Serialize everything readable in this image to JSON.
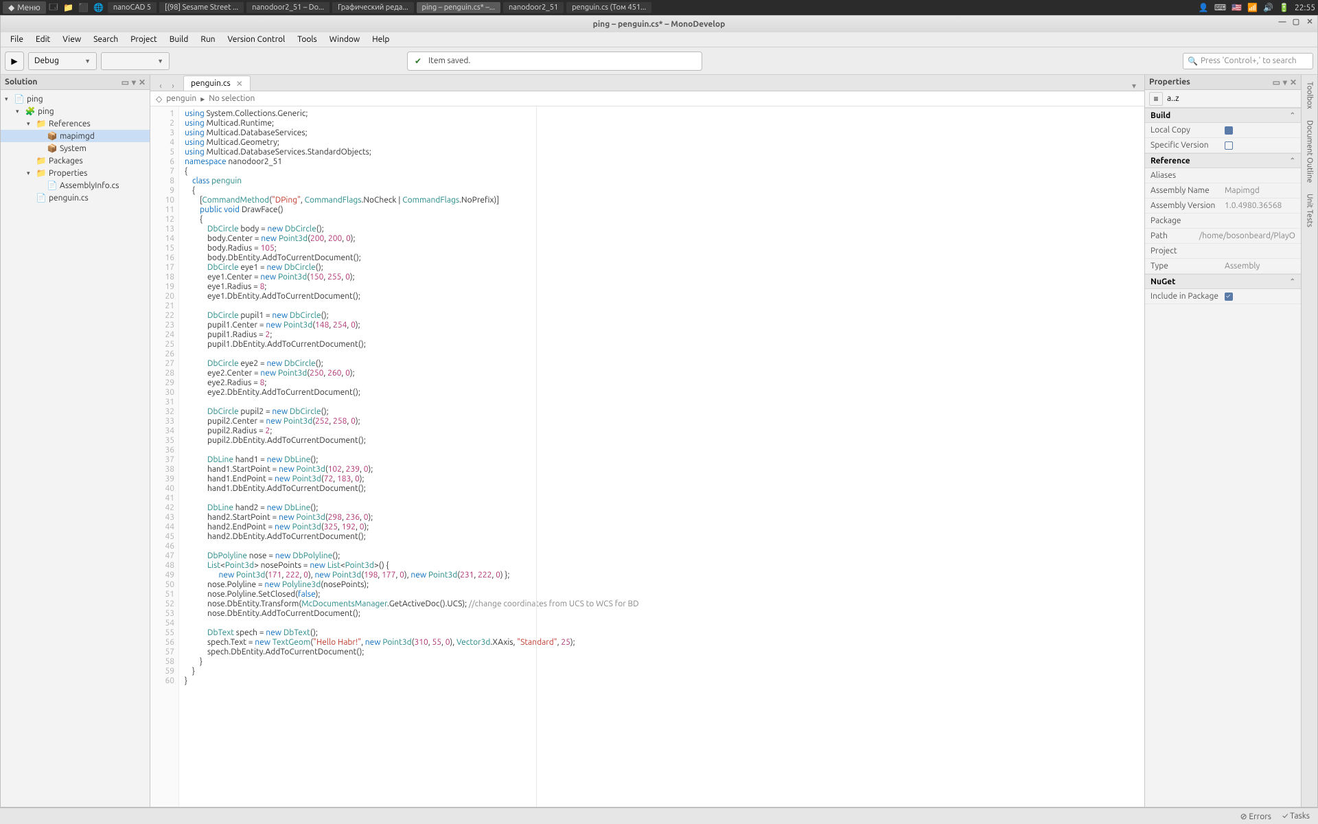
{
  "taskbar": {
    "menu_label": "Меню",
    "tasks": [
      {
        "label": "nanoCAD 5",
        "active": false
      },
      {
        "label": "[(98] Sesame Street ...",
        "active": false
      },
      {
        "label": "nanodoor2_51 – Do...",
        "active": false
      },
      {
        "label": "Графический реда...",
        "active": false
      },
      {
        "label": "ping – penguin.cs* –...",
        "active": true
      },
      {
        "label": "nanodoor2_51",
        "active": false
      },
      {
        "label": "penguin.cs (Том 451...",
        "active": false
      }
    ],
    "clock": "22:55"
  },
  "title": "ping – penguin.cs* – MonoDevelop",
  "menu": [
    "File",
    "Edit",
    "View",
    "Search",
    "Project",
    "Build",
    "Run",
    "Version Control",
    "Tools",
    "Window",
    "Help"
  ],
  "config_combo": "Debug",
  "saved_text": "Item saved.",
  "search_placeholder": "Press 'Control+,' to search",
  "solution_title": "Solution",
  "tree": [
    {
      "depth": 1,
      "twisty": "▾",
      "icon": "📄",
      "label": "ping"
    },
    {
      "depth": 2,
      "twisty": "▾",
      "icon": "🧩",
      "label": "ping"
    },
    {
      "depth": 3,
      "twisty": "▾",
      "icon": "📁",
      "label": "References"
    },
    {
      "depth": 4,
      "twisty": "",
      "icon": "📦",
      "label": "mapimgd",
      "selected": true
    },
    {
      "depth": 4,
      "twisty": "",
      "icon": "📦",
      "label": "System"
    },
    {
      "depth": 3,
      "twisty": "",
      "icon": "📁",
      "label": "Packages"
    },
    {
      "depth": 3,
      "twisty": "▾",
      "icon": "📁",
      "label": "Properties"
    },
    {
      "depth": 4,
      "twisty": "",
      "icon": "📄",
      "label": "AssemblyInfo.cs"
    },
    {
      "depth": 3,
      "twisty": "",
      "icon": "📄",
      "label": "penguin.cs"
    }
  ],
  "tab_name": "penguin.cs",
  "breadcrumb": {
    "file": "penguin",
    "sel": "No selection"
  },
  "code_lines": [
    "<span class='kw'>using</span> System.Collections.Generic;",
    "<span class='kw'>using</span> Multicad.Runtime;",
    "<span class='kw'>using</span> Multicad.DatabaseServices;",
    "<span class='kw'>using</span> Multicad.Geometry;",
    "<span class='kw'>using</span> Multicad.DatabaseServices.StandardObjects;",
    "<span class='kw'>namespace</span> nanodoor2_51",
    "{",
    "    <span class='kw'>class</span> <span class='ty'>penguin</span>",
    "    {",
    "        [<span class='ty'>CommandMethod</span>(<span class='st'>\"DPing\"</span>, <span class='ty'>CommandFlags</span>.NoCheck | <span class='ty'>CommandFlags</span>.NoPrefix)]",
    "        <span class='kw'>public</span> <span class='kw'>void</span> DrawFace()",
    "        {",
    "            <span class='ty'>DbCircle</span> body = <span class='kw'>new</span> <span class='ty'>DbCircle</span>();",
    "            body.Center = <span class='kw'>new</span> <span class='ty'>Point3d</span>(<span class='nu'>200</span>, <span class='nu'>200</span>, <span class='nu'>0</span>);",
    "            body.Radius = <span class='nu'>105</span>;",
    "            body.DbEntity.AddToCurrentDocument();",
    "            <span class='ty'>DbCircle</span> eye1 = <span class='kw'>new</span> <span class='ty'>DbCircle</span>();",
    "            eye1.Center = <span class='kw'>new</span> <span class='ty'>Point3d</span>(<span class='nu'>150</span>, <span class='nu'>255</span>, <span class='nu'>0</span>);",
    "            eye1.Radius = <span class='nu'>8</span>;",
    "            eye1.DbEntity.AddToCurrentDocument();",
    "",
    "            <span class='ty'>DbCircle</span> pupil1 = <span class='kw'>new</span> <span class='ty'>DbCircle</span>();",
    "            pupil1.Center = <span class='kw'>new</span> <span class='ty'>Point3d</span>(<span class='nu'>148</span>, <span class='nu'>254</span>, <span class='nu'>0</span>);",
    "            pupil1.Radius = <span class='nu'>2</span>;",
    "            pupil1.DbEntity.AddToCurrentDocument();",
    "",
    "            <span class='ty'>DbCircle</span> eye2 = <span class='kw'>new</span> <span class='ty'>DbCircle</span>();",
    "            eye2.Center = <span class='kw'>new</span> <span class='ty'>Point3d</span>(<span class='nu'>250</span>, <span class='nu'>260</span>, <span class='nu'>0</span>);",
    "            eye2.Radius = <span class='nu'>8</span>;",
    "            eye2.DbEntity.AddToCurrentDocument();",
    "",
    "            <span class='ty'>DbCircle</span> pupil2 = <span class='kw'>new</span> <span class='ty'>DbCircle</span>();",
    "            pupil2.Center = <span class='kw'>new</span> <span class='ty'>Point3d</span>(<span class='nu'>252</span>, <span class='nu'>258</span>, <span class='nu'>0</span>);",
    "            pupil2.Radius = <span class='nu'>2</span>;",
    "            pupil2.DbEntity.AddToCurrentDocument();",
    "",
    "            <span class='ty'>DbLine</span> hand1 = <span class='kw'>new</span> <span class='ty'>DbLine</span>();",
    "            hand1.StartPoint = <span class='kw'>new</span> <span class='ty'>Point3d</span>(<span class='nu'>102</span>, <span class='nu'>239</span>, <span class='nu'>0</span>);",
    "            hand1.EndPoint = <span class='kw'>new</span> <span class='ty'>Point3d</span>(<span class='nu'>72</span>, <span class='nu'>183</span>, <span class='nu'>0</span>);",
    "            hand1.DbEntity.AddToCurrentDocument();",
    "",
    "            <span class='ty'>DbLine</span> hand2 = <span class='kw'>new</span> <span class='ty'>DbLine</span>();",
    "            hand2.StartPoint = <span class='kw'>new</span> <span class='ty'>Point3d</span>(<span class='nu'>298</span>, <span class='nu'>236</span>, <span class='nu'>0</span>);",
    "            hand2.EndPoint = <span class='kw'>new</span> <span class='ty'>Point3d</span>(<span class='nu'>325</span>, <span class='nu'>192</span>, <span class='nu'>0</span>);",
    "            hand2.DbEntity.AddToCurrentDocument();",
    "",
    "            <span class='ty'>DbPolyline</span> nose = <span class='kw'>new</span> <span class='ty'>DbPolyline</span>();",
    "            <span class='ty'>List</span>&lt;<span class='ty'>Point3d</span>&gt; nosePoints = <span class='kw'>new</span> <span class='ty'>List</span>&lt;<span class='ty'>Point3d</span>&gt;() {",
    "                  <span class='kw'>new</span> <span class='ty'>Point3d</span>(<span class='nu'>171</span>, <span class='nu'>222</span>, <span class='nu'>0</span>), <span class='kw'>new</span> <span class='ty'>Point3d</span>(<span class='nu'>198</span>, <span class='nu'>177</span>, <span class='nu'>0</span>), <span class='kw'>new</span> <span class='ty'>Point3d</span>(<span class='nu'>231</span>, <span class='nu'>222</span>, <span class='nu'>0</span>) };",
    "            nose.Polyline = <span class='kw'>new</span> <span class='ty'>Polyline3d</span>(nosePoints);",
    "            nose.Polyline.SetClosed(<span class='kw'>false</span>);",
    "            nose.DbEntity.Transform(<span class='ty'>McDocumentsManager</span>.GetActiveDoc().UCS); <span class='cm'>//change coordinates from UCS to WCS for BD</span>",
    "            nose.DbEntity.AddToCurrentDocument();",
    "",
    "            <span class='ty'>DbText</span> spech = <span class='kw'>new</span> <span class='ty'>DbText</span>();",
    "            spech.Text = <span class='kw'>new</span> <span class='ty'>TextGeom</span>(<span class='st'>\"Hello Habr!\"</span>, <span class='kw'>new</span> <span class='ty'>Point3d</span>(<span class='nu'>310</span>, <span class='nu'>55</span>, <span class='nu'>0</span>), <span class='ty'>Vector3d</span>.XAxis, <span class='st'>\"Standard\"</span>, <span class='nu'>25</span>);",
    "            spech.DbEntity.AddToCurrentDocument();",
    "        }",
    "    }",
    "}"
  ],
  "props_title": "Properties",
  "prop_filter": "a..z",
  "sections": {
    "build": "Build",
    "reference": "Reference",
    "nuget": "NuGet"
  },
  "props": {
    "local_copy": {
      "k": "Local Copy",
      "v": true
    },
    "specific_version": {
      "k": "Specific Version",
      "v": false
    },
    "aliases": {
      "k": "Aliases",
      "v": ""
    },
    "assembly_name": {
      "k": "Assembly Name",
      "v": "Mapimgd"
    },
    "assembly_version": {
      "k": "Assembly Version",
      "v": "1.0.4980.36568"
    },
    "package": {
      "k": "Package",
      "v": ""
    },
    "path": {
      "k": "Path",
      "v": "/home/bosonbeard/PlayO"
    },
    "project": {
      "k": "Project",
      "v": ""
    },
    "type": {
      "k": "Type",
      "v": "Assembly"
    },
    "include_pkg": {
      "k": "Include in Package",
      "v": true
    }
  },
  "rightstrip": [
    "Toolbox",
    "Document Outline",
    "Unit Tests"
  ],
  "status": {
    "errors": "Errors",
    "tasks": "Tasks"
  }
}
